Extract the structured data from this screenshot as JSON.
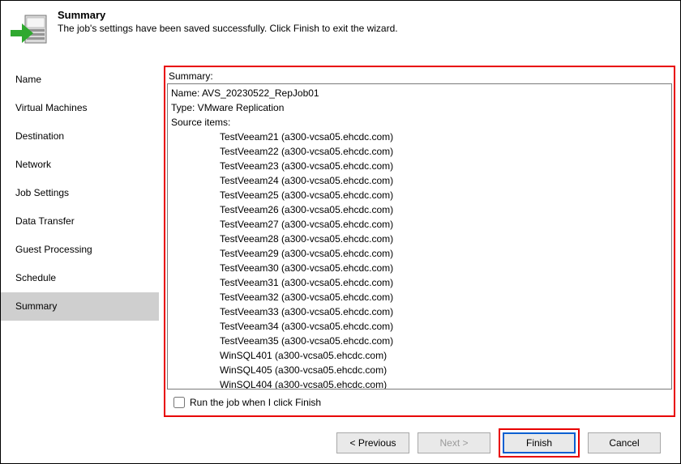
{
  "header": {
    "title": "Summary",
    "subtitle": "The job's settings have been saved successfully. Click Finish to exit the wizard."
  },
  "sidebar": {
    "items": [
      {
        "label": "Name"
      },
      {
        "label": "Virtual Machines"
      },
      {
        "label": "Destination"
      },
      {
        "label": "Network"
      },
      {
        "label": "Job Settings"
      },
      {
        "label": "Data Transfer"
      },
      {
        "label": "Guest Processing"
      },
      {
        "label": "Schedule"
      },
      {
        "label": "Summary"
      }
    ],
    "selected_index": 8
  },
  "summary": {
    "label": "Summary:",
    "name_line": "Name: AVS_20230522_RepJob01",
    "type_line": "Type: VMware Replication",
    "source_header": "Source items:",
    "source_items": [
      "TestVeeam21 (a300-vcsa05.ehcdc.com)",
      "TestVeeam22 (a300-vcsa05.ehcdc.com)",
      "TestVeeam23 (a300-vcsa05.ehcdc.com)",
      "TestVeeam24 (a300-vcsa05.ehcdc.com)",
      "TestVeeam25 (a300-vcsa05.ehcdc.com)",
      "TestVeeam26 (a300-vcsa05.ehcdc.com)",
      "TestVeeam27 (a300-vcsa05.ehcdc.com)",
      "TestVeeam28 (a300-vcsa05.ehcdc.com)",
      "TestVeeam29 (a300-vcsa05.ehcdc.com)",
      "TestVeeam30 (a300-vcsa05.ehcdc.com)",
      "TestVeeam31 (a300-vcsa05.ehcdc.com)",
      "TestVeeam32 (a300-vcsa05.ehcdc.com)",
      "TestVeeam33 (a300-vcsa05.ehcdc.com)",
      "TestVeeam34 (a300-vcsa05.ehcdc.com)",
      "TestVeeam35 (a300-vcsa05.ehcdc.com)",
      "WinSQL401 (a300-vcsa05.ehcdc.com)",
      "WinSQL405 (a300-vcsa05.ehcdc.com)",
      "WinSQL404 (a300-vcsa05.ehcdc.com)"
    ],
    "run_checkbox_label": "Run the job when I click Finish",
    "run_checked": false
  },
  "buttons": {
    "previous": "< Previous",
    "next": "Next >",
    "finish": "Finish",
    "cancel": "Cancel"
  }
}
